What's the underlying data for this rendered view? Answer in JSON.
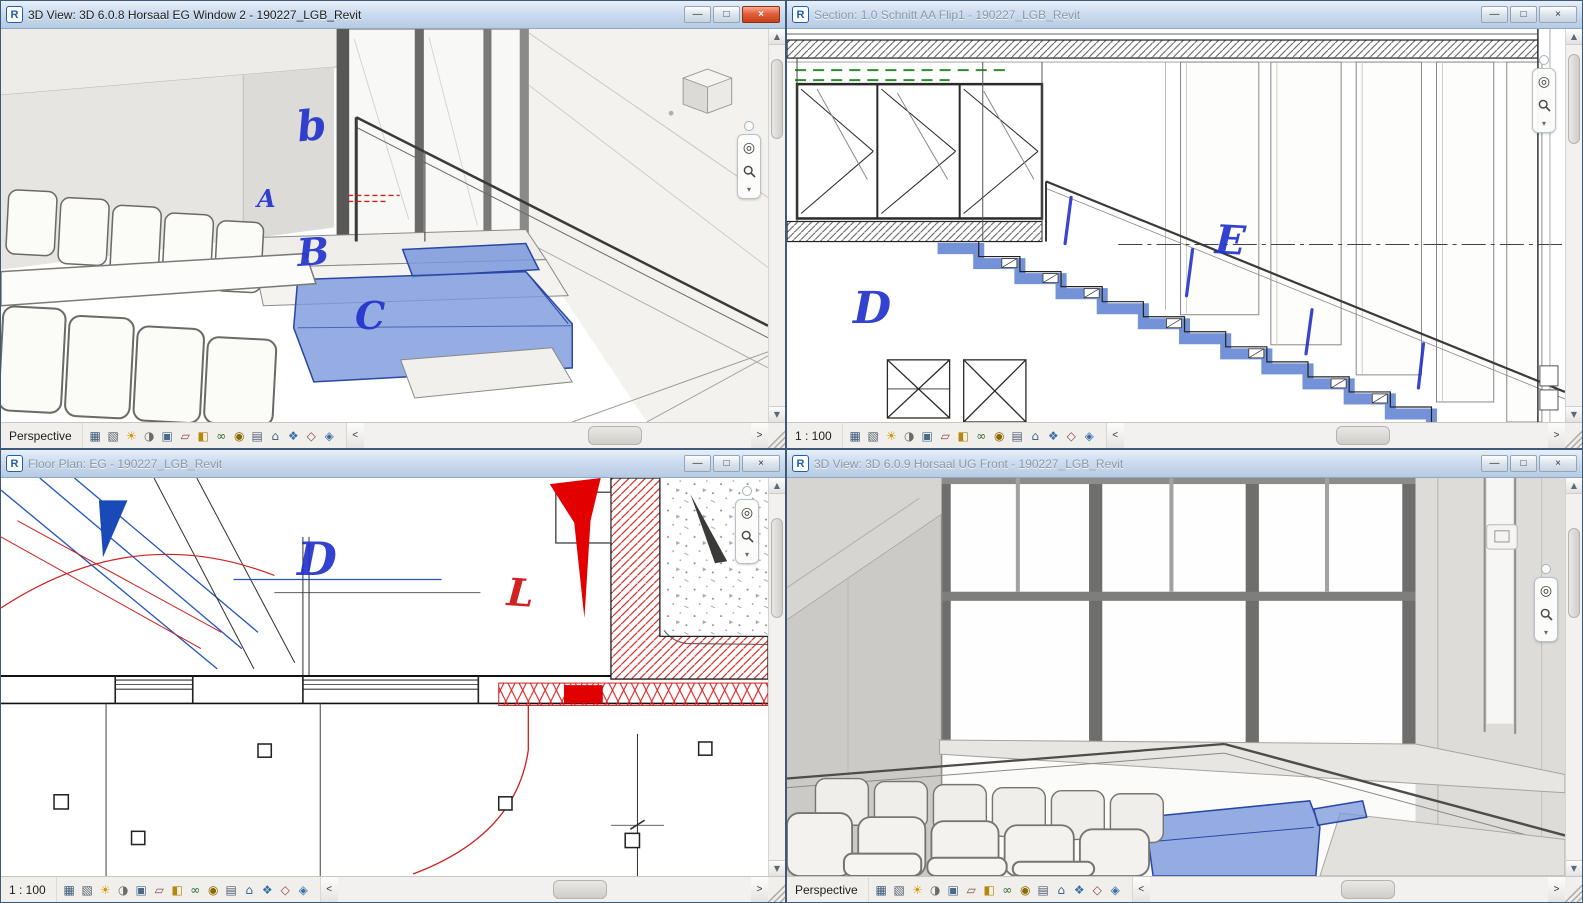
{
  "app": {
    "logo_letter": "R",
    "buttons": {
      "minimize": "—",
      "maximize": "□",
      "close": "×"
    }
  },
  "scrollbar": {
    "up": "▲",
    "down": "▼",
    "left": "<",
    "right": ">"
  },
  "windows": {
    "top_left": {
      "title": "3D View: 3D 6.0.8 Horsaal EG Window 2 - 190227_LGB_Revit",
      "scale_label": "Perspective",
      "ink": {
        "b": "b",
        "a": "A",
        "bb": "B",
        "c": "C"
      }
    },
    "top_right": {
      "title": "Section: 1.0 Schnitt AA Flip1 - 190227_LGB_Revit",
      "scale_label": "1 : 100",
      "ink": {
        "d": "D",
        "e": "E"
      }
    },
    "bottom_left": {
      "title": "Floor Plan: EG - 190227_LGB_Revit",
      "scale_label": "1 : 100",
      "ink": {
        "d": "D",
        "l": "L"
      }
    },
    "bottom_right": {
      "title": "3D View: 3D 6.0.9 Horsaal UG Front - 190227_LGB_Revit",
      "scale_label": "Perspective"
    }
  },
  "view_control_bar": {
    "icons": [
      {
        "name": "background",
        "glyph": "▦",
        "color": "#3d5a78"
      },
      {
        "name": "visual-style",
        "glyph": "▧",
        "color": "#55606a"
      },
      {
        "name": "sun-path",
        "glyph": "☀",
        "color": "#d99400"
      },
      {
        "name": "shadows",
        "glyph": "◑",
        "color": "#6a6a66"
      },
      {
        "name": "crop-view",
        "glyph": "▣",
        "color": "#4a6a8a"
      },
      {
        "name": "hide-crop",
        "glyph": "▱",
        "color": "#8a4a4a"
      },
      {
        "name": "unlocked-view",
        "glyph": "◧",
        "color": "#b8860b"
      },
      {
        "name": "temporary-hide",
        "glyph": "∞",
        "color": "#2a6a2a"
      },
      {
        "name": "reveal-hidden",
        "glyph": "◉",
        "color": "#8a6a00"
      },
      {
        "name": "view-properties",
        "glyph": "▤",
        "color": "#556077"
      },
      {
        "name": "analytical-model",
        "glyph": "⌂",
        "color": "#446688"
      },
      {
        "name": "displacement-sets",
        "glyph": "❖",
        "color": "#3a6ea5"
      },
      {
        "name": "reveal-constraints",
        "glyph": "◇",
        "color": "#884444"
      },
      {
        "name": "worksharing",
        "glyph": "◈",
        "color": "#3a6ea5"
      }
    ]
  },
  "navigation_bar": {
    "wheel": "◎",
    "chevron": "▾"
  },
  "colors": {
    "selection_highlight": "#7b98dc",
    "ink_blue": "#2233cc",
    "ink_red": "#cc1111",
    "plan_red": "#cc2222",
    "plan_blue": "#2255bb",
    "dashed_green": "#2e8b2e",
    "titlebar_active_close": "#c6401c"
  }
}
